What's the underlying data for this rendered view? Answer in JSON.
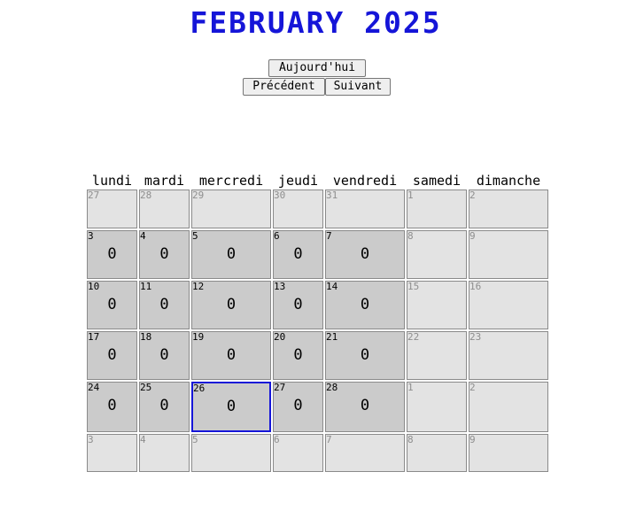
{
  "header": {
    "title": "February 2025"
  },
  "nav": {
    "today_label": "Aujourd'hui",
    "prev_label": "Précédent",
    "next_label": "Suivant"
  },
  "calendar": {
    "weekdays": [
      "lundi",
      "mardi",
      "mercredi",
      "jeudi",
      "vendredi",
      "samedi",
      "dimanche"
    ],
    "weeks": [
      [
        {
          "day": "27"
        },
        {
          "day": "28"
        },
        {
          "day": "29"
        },
        {
          "day": "30"
        },
        {
          "day": "31"
        },
        {
          "day": "1"
        },
        {
          "day": "2"
        }
      ],
      [
        {
          "day": "3",
          "count": "0"
        },
        {
          "day": "4",
          "count": "0"
        },
        {
          "day": "5",
          "count": "0"
        },
        {
          "day": "6",
          "count": "0"
        },
        {
          "day": "7",
          "count": "0"
        },
        {
          "day": "8"
        },
        {
          "day": "9"
        }
      ],
      [
        {
          "day": "10",
          "count": "0"
        },
        {
          "day": "11",
          "count": "0"
        },
        {
          "day": "12",
          "count": "0"
        },
        {
          "day": "13",
          "count": "0"
        },
        {
          "day": "14",
          "count": "0"
        },
        {
          "day": "15"
        },
        {
          "day": "16"
        }
      ],
      [
        {
          "day": "17",
          "count": "0"
        },
        {
          "day": "18",
          "count": "0"
        },
        {
          "day": "19",
          "count": "0"
        },
        {
          "day": "20",
          "count": "0"
        },
        {
          "day": "21",
          "count": "0"
        },
        {
          "day": "22"
        },
        {
          "day": "23"
        }
      ],
      [
        {
          "day": "24",
          "count": "0"
        },
        {
          "day": "25",
          "count": "0"
        },
        {
          "day": "26",
          "count": "0",
          "today": true
        },
        {
          "day": "27",
          "count": "0"
        },
        {
          "day": "28",
          "count": "0"
        },
        {
          "day": "1"
        },
        {
          "day": "2"
        }
      ],
      [
        {
          "day": "3"
        },
        {
          "day": "4"
        },
        {
          "day": "5"
        },
        {
          "day": "6"
        },
        {
          "day": "7"
        },
        {
          "day": "8"
        },
        {
          "day": "9"
        }
      ]
    ]
  },
  "colors": {
    "accent": "#1515d8",
    "workday_cell": "#cbcbcb",
    "other_cell": "#e3e3e3",
    "muted_text": "#8e8e8e"
  }
}
